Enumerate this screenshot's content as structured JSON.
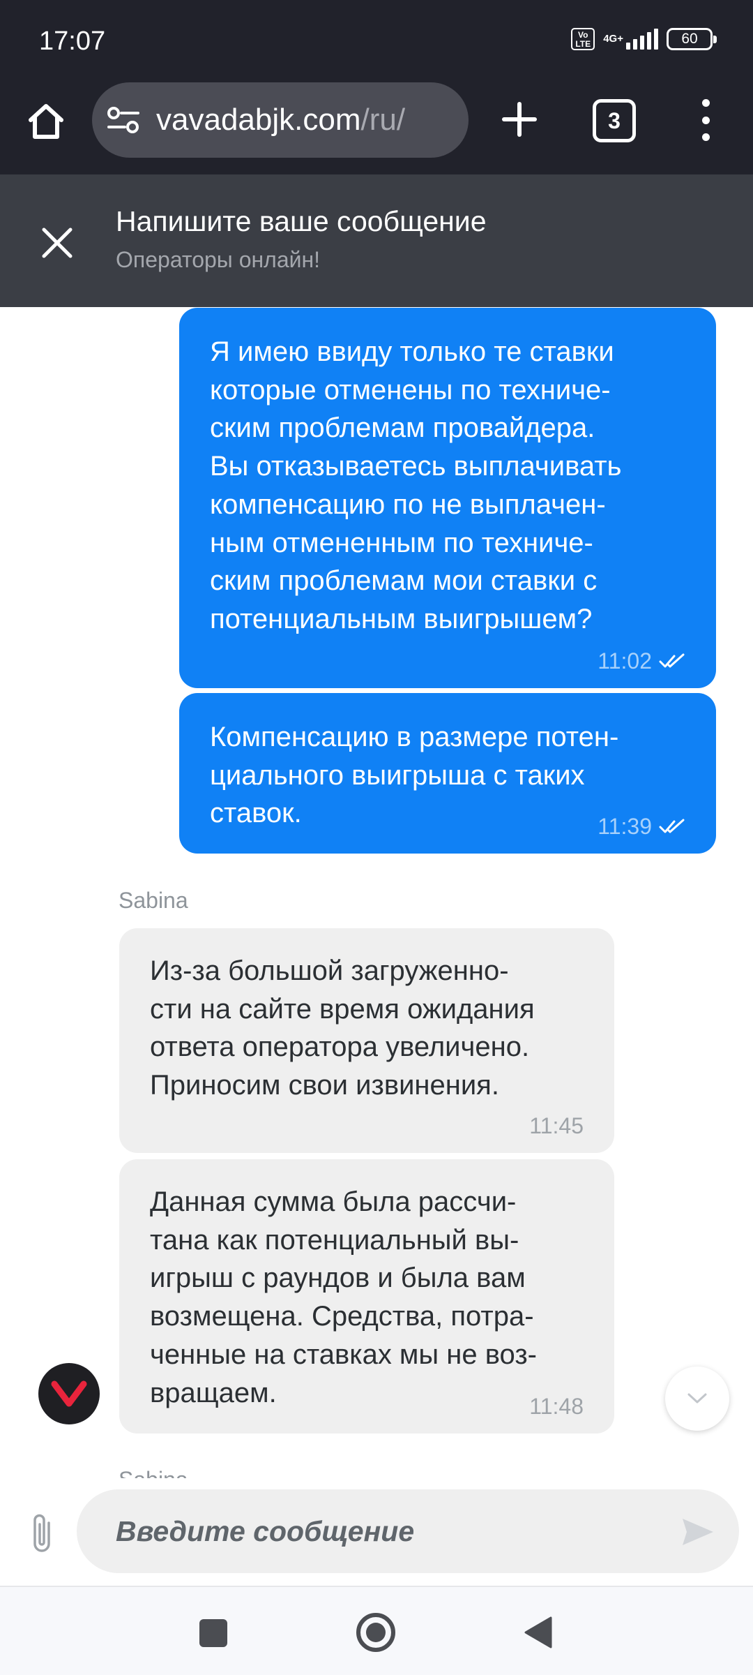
{
  "status_bar": {
    "time": "17:07",
    "volte": "Vo\nLTE",
    "network": "4G+",
    "battery": "60",
    "icons": [
      "volte-icon",
      "signal-icon",
      "battery-icon"
    ]
  },
  "browser": {
    "url_host": "vavadabjk.com",
    "url_path": "/ru/",
    "tab_count": "3",
    "icons": [
      "home-icon",
      "site-settings-icon",
      "new-tab-icon",
      "tab-switcher-icon",
      "more-menu-icon"
    ]
  },
  "chat_header": {
    "title": "Напишите ваше сообщение",
    "subtitle": "Операторы онлайн!"
  },
  "messages": [
    {
      "direction": "outgoing",
      "text": "Я имею ввиду только те ставки\nкоторые отменены по техниче-\nским проблемам провайдера.\nВы отказываетесь выплачивать\nкомпенсацию по не выплачен-\nным отмененным по техниче-\nским проблемам мои ставки с\nпотенциальным выигрышем?",
      "time": "11:02",
      "read": true
    },
    {
      "direction": "outgoing",
      "text": "Компенсацию в размере потен-\nциального выигрыша с таких\nставок.",
      "time": "11:39",
      "read": true
    },
    {
      "direction": "incoming",
      "text": "Из-за большой загруженно-\nсти на сайте время ожидания\nответа оператора увеличено.\nПриносим свои извинения.",
      "time": "11:45"
    },
    {
      "direction": "incoming",
      "text": "Данная сумма была рассчи-\nтана как потенциальный вы-\nигрыш с раундов и была вам\nвозмещена. Средства, потра-\nченные на ставках мы не воз-\nвращаем.",
      "time": "11:48"
    }
  ],
  "sender_name": "Sabina",
  "composer": {
    "placeholder": "Введите сообщение"
  },
  "colors": {
    "outgoing_bubble": "#1081f5",
    "incoming_bubble": "#efefef",
    "toolbar_bg": "#21222b",
    "chat_header_bg": "#3b3e45",
    "avatar_accent": "#e8243c"
  }
}
